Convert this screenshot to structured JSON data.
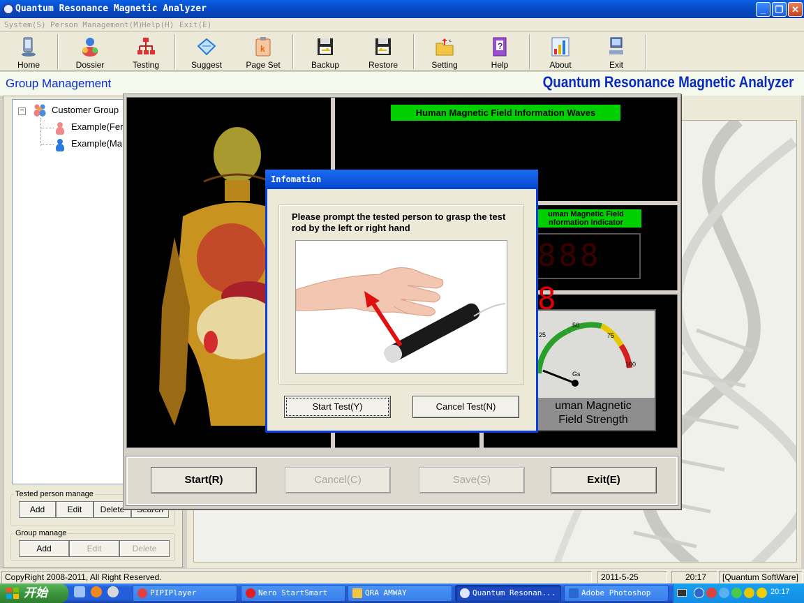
{
  "window": {
    "title": "Quantum Resonance Magnetic Analyzer",
    "controls": {
      "minimize": "_",
      "maximize": "❐",
      "close": "✕"
    }
  },
  "menu": [
    "System(S)",
    "Person Management(M)",
    "Help(H)",
    "Exit(E)"
  ],
  "toolbar": [
    {
      "label": "Home",
      "icon": "computer-icon"
    },
    {
      "label": "Dossier",
      "icon": "users-icon"
    },
    {
      "label": "Testing",
      "icon": "network-icon"
    },
    {
      "label": "Suggest",
      "icon": "diamond-icon"
    },
    {
      "label": "Page Set",
      "icon": "clipboard-icon"
    },
    {
      "label": "Backup",
      "icon": "disk-icon"
    },
    {
      "label": "Restore",
      "icon": "disk-restore-icon"
    },
    {
      "label": "Setting",
      "icon": "folder-icon"
    },
    {
      "label": "Help",
      "icon": "help-book-icon"
    },
    {
      "label": "About",
      "icon": "chart-icon"
    },
    {
      "label": "Exit",
      "icon": "exit-computer-icon"
    }
  ],
  "header": {
    "section_title": "Group Management",
    "brand": "Quantum Resonance Magnetic Analyzer"
  },
  "tree": {
    "root": "Customer Group",
    "root_expander": "−",
    "children": [
      "Example(Fer",
      "Example(Ma"
    ]
  },
  "tested_person": {
    "legend": "Tested person manage",
    "buttons": [
      "Add",
      "Edit",
      "Delete",
      "Search"
    ]
  },
  "group_manage": {
    "legend": "Group manage",
    "buttons": [
      "Add",
      "Edit",
      "Delete"
    ]
  },
  "test_window": {
    "wave_label": "Human Magnetic Field Information Waves",
    "indicator_label": "uman Magnetic Field\nnformation Indicator",
    "digits": "8888",
    "gauge": {
      "ticks": [
        "25",
        "50",
        "75",
        "100"
      ],
      "unit": "Gs",
      "label": "uman Magnetic\nField Strength"
    },
    "buttons": [
      {
        "label": "Start(R)",
        "enabled": true
      },
      {
        "label": "Cancel(C)",
        "enabled": false
      },
      {
        "label": "Save(S)",
        "enabled": false
      },
      {
        "label": "Exit(E)",
        "enabled": true
      }
    ]
  },
  "dialog": {
    "title": "Infomation",
    "message": "Please prompt the tested person to grasp the test rod by the left or right hand",
    "start_button": "Start Test(Y)",
    "cancel_button": "Cancel Test(N)"
  },
  "status": {
    "copyright": "CopyRight 2008-2011, All Right Reserved.",
    "date": "2011-5-25",
    "time": "20:17",
    "company": "[Quantum SoftWare]"
  },
  "taskbar": {
    "start": "开始",
    "tasks": [
      "PIPIPlayer",
      "Nero StartSmart",
      "QRA AMWAY",
      "Quantum Resonan...",
      "Adobe Photoshop"
    ],
    "clock": "20:17"
  },
  "colors": {
    "accent_blue": "#0a2cd0",
    "indicator_green": "#00d000",
    "digit_red": "#e00000",
    "titlebar_blue": "#0a5fe3"
  }
}
